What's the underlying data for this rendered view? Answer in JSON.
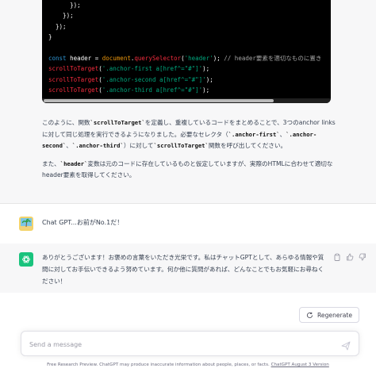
{
  "code": {
    "lines": [
      [
        {
          "t": "      });",
          "c": ""
        }
      ],
      [
        {
          "t": "    });",
          "c": ""
        }
      ],
      [
        {
          "t": "  });",
          "c": ""
        }
      ],
      [
        {
          "t": "}",
          "c": ""
        }
      ],
      [
        {
          "t": "",
          "c": ""
        }
      ],
      [
        {
          "t": "const ",
          "c": "kw"
        },
        {
          "t": "header",
          "c": ""
        },
        {
          "t": " = ",
          "c": ""
        },
        {
          "t": "document",
          "c": "var"
        },
        {
          "t": ".",
          "c": ""
        },
        {
          "t": "querySelector",
          "c": "fn"
        },
        {
          "t": "(",
          "c": ""
        },
        {
          "t": "'header'",
          "c": "str"
        },
        {
          "t": "); ",
          "c": ""
        },
        {
          "t": "// header要素を適切なものに置き",
          "c": "cmt"
        }
      ],
      [
        {
          "t": "scrollToTarget",
          "c": "fn"
        },
        {
          "t": "(",
          "c": ""
        },
        {
          "t": "'.anchor-first a[href^=\"#\"]'",
          "c": "str"
        },
        {
          "t": ");",
          "c": ""
        }
      ],
      [
        {
          "t": "scrollToTarget",
          "c": "fn"
        },
        {
          "t": "(",
          "c": ""
        },
        {
          "t": "'.anchor-second a[href^=\"#\"]'",
          "c": "str"
        },
        {
          "t": ");",
          "c": ""
        }
      ],
      [
        {
          "t": "scrollToTarget",
          "c": "fn"
        },
        {
          "t": "(",
          "c": ""
        },
        {
          "t": "'.anchor-third a[href^=\"#\"]'",
          "c": "str"
        },
        {
          "t": ");",
          "c": ""
        }
      ]
    ]
  },
  "answer": {
    "p1_a": "このように、関数",
    "p1_code1": "`scrollToTarget`",
    "p1_b": "を定義し、重複しているコードをまとめることで、3つのanchor linksに対して同じ処理を実行できるようになりました。必要なセレクタ（",
    "p1_code2": "`.anchor-first`",
    "p1_sep1": "、",
    "p1_code3": "`.anchor-second`",
    "p1_sep2": "、",
    "p1_code4": "`.anchor-third`",
    "p1_c": "）に対して",
    "p1_code5": "`scrollToTarget`",
    "p1_d": "関数を呼び出してください。",
    "p2_a": "また、",
    "p2_code": "`header`",
    "p2_b": "変数は元のコードに存在しているものと仮定していますが、実際のHTMLに合わせて適切なheader要素を取得してください。"
  },
  "user_message": "Chat GPT...お前がNo.1だ！",
  "bot_message": "ありがとうございます！お褒めの言葉をいただき光栄です。私はチャットGPTとして、あらゆる情報や質問に対してお手伝いできるよう努めています。何か他に質問があれば、どんなことでもお気軽にお尋ねください！",
  "regenerate_label": "Regenerate",
  "input_placeholder": "Send a message",
  "footer": {
    "text": "Free Research Preview. ChatGPT may produce inaccurate information about people, places, or facts. ",
    "link": "ChatGPT August 3 Version"
  },
  "icons": {
    "user_avatar": "palm-tree-icon",
    "bot_avatar": "openai-logo-icon",
    "copy": "clipboard-icon",
    "thumbs_up": "thumbs-up-icon",
    "thumbs_down": "thumbs-down-icon",
    "regenerate": "refresh-icon",
    "send": "paper-plane-icon"
  },
  "colors": {
    "bot_avatar_bg": "#19c37d",
    "user_avatar_bg": "#f3d36b",
    "code_bg": "#000000"
  }
}
